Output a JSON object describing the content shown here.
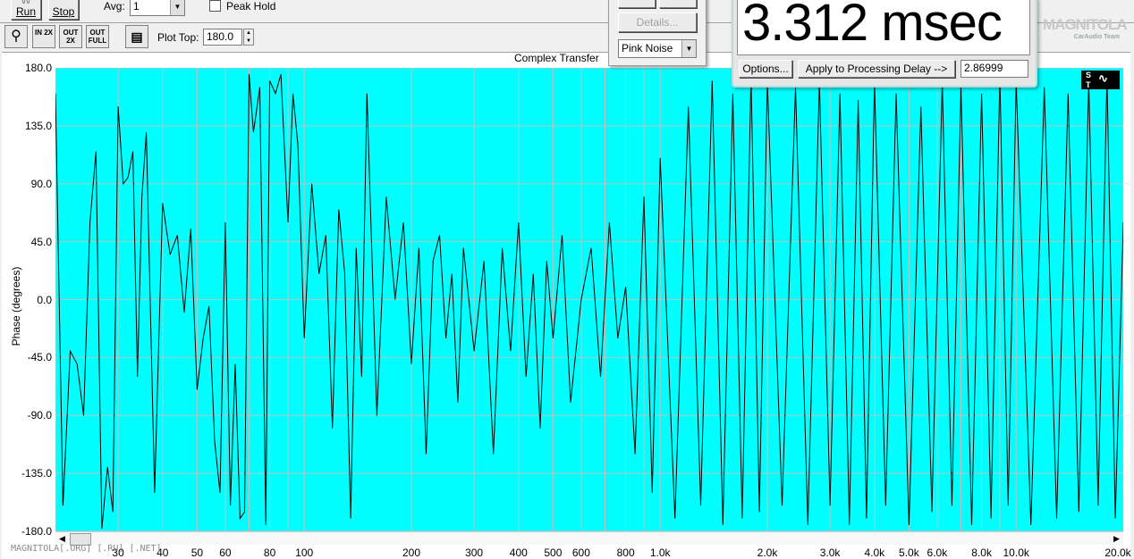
{
  "toolbar": {
    "run_label": "Run",
    "stop_label": "Stop",
    "avg_label": "Avg:",
    "avg_value": "1",
    "peak_hold_label": "Peak Hold",
    "plot_top_label": "Plot Top:",
    "plot_top_value": "180.0",
    "zoom_in_label": "IN 2X",
    "zoom_out_label": "OUT 2X",
    "zoom_full_label": "OUT FULL"
  },
  "panel": {
    "details_label": "Details...",
    "signal_select": "Pink Noise"
  },
  "delay": {
    "display": "3.312 msec",
    "options_label": "Options...",
    "apply_label": "Apply to Processing Delay -->",
    "apply_value": "2.86999"
  },
  "watermark": {
    "logo_text": "MAGNITOLA",
    "logo_sub": "CarAudio Team",
    "footer_text": "MAGNITOLA[.ORG] [.RU] [.NET]"
  },
  "chart_data": {
    "type": "line",
    "title": "Complex Transfer",
    "ylabel": "Phase (degrees)",
    "xlabel": "",
    "x_scale": "log",
    "xlim": [
      20,
      20000
    ],
    "ylim": [
      -180,
      180
    ],
    "grid": true,
    "y_ticks": [
      "180.0",
      "135.0",
      "90.0",
      "45.0",
      "0.0",
      "-45.0",
      "-90.0",
      "-135.0",
      "-180.0"
    ],
    "x_ticks": [
      {
        "value": 30,
        "label": "30"
      },
      {
        "value": 40,
        "label": "40"
      },
      {
        "value": 50,
        "label": "50"
      },
      {
        "value": 60,
        "label": "60"
      },
      {
        "value": 80,
        "label": "80"
      },
      {
        "value": 100,
        "label": "100"
      },
      {
        "value": 200,
        "label": "200"
      },
      {
        "value": 300,
        "label": "300"
      },
      {
        "value": 400,
        "label": "400"
      },
      {
        "value": 500,
        "label": "500"
      },
      {
        "value": 600,
        "label": "600"
      },
      {
        "value": 800,
        "label": "800"
      },
      {
        "value": 1000,
        "label": "1.0k"
      },
      {
        "value": 2000,
        "label": "2.0k"
      },
      {
        "value": 3000,
        "label": "3.0k"
      },
      {
        "value": 4000,
        "label": "4.0k"
      },
      {
        "value": 5000,
        "label": "5.0k"
      },
      {
        "value": 6000,
        "label": "6.0k"
      },
      {
        "value": 8000,
        "label": "8.0k"
      },
      {
        "value": 10000,
        "label": "10.0k"
      },
      {
        "value": 20000,
        "label": "20.0k"
      }
    ],
    "series": [
      {
        "color": "#000000",
        "x": [
          20,
          21,
          22,
          23,
          24,
          25,
          26,
          27,
          28,
          29,
          30,
          31,
          32,
          33,
          34,
          35,
          36,
          38,
          40,
          42,
          44,
          46,
          48,
          50,
          52,
          54,
          56,
          58,
          60,
          62,
          64,
          66,
          68,
          70,
          72,
          75,
          78,
          80,
          83,
          86,
          90,
          93,
          96,
          100,
          105,
          110,
          115,
          120,
          125,
          130,
          135,
          140,
          145,
          150,
          160,
          170,
          180,
          190,
          200,
          210,
          220,
          230,
          240,
          250,
          260,
          270,
          280,
          290,
          300,
          320,
          340,
          360,
          380,
          400,
          420,
          440,
          460,
          480,
          500,
          530,
          560,
          600,
          640,
          680,
          720,
          760,
          800,
          850,
          900,
          950,
          1000,
          1100,
          1200,
          1300,
          1400,
          1500,
          1600,
          1700,
          1800,
          1900,
          2000,
          2200,
          2400,
          2600,
          2800,
          3000,
          3200,
          3400,
          3600,
          3800,
          4000,
          4300,
          4600,
          5000,
          5400,
          5800,
          6200,
          6600,
          7000,
          7500,
          8000,
          8500,
          9000,
          9500,
          10000,
          11000,
          12000,
          13000,
          14000,
          15000,
          16000,
          17000,
          18000,
          19000,
          20000
        ],
        "y": [
          160,
          -160,
          -40,
          -50,
          -90,
          60,
          115,
          -178,
          -130,
          -165,
          150,
          90,
          95,
          115,
          -60,
          80,
          130,
          -150,
          75,
          35,
          50,
          -10,
          55,
          -70,
          -30,
          -5,
          -110,
          -150,
          60,
          -160,
          -50,
          -170,
          -165,
          175,
          130,
          165,
          -175,
          170,
          160,
          175,
          60,
          160,
          120,
          -30,
          90,
          20,
          50,
          -100,
          70,
          20,
          -170,
          40,
          -60,
          160,
          -90,
          80,
          0,
          60,
          -50,
          40,
          -120,
          30,
          50,
          -30,
          20,
          -80,
          40,
          0,
          -40,
          30,
          -120,
          40,
          -40,
          60,
          -60,
          20,
          -100,
          30,
          -30,
          50,
          -80,
          0,
          40,
          -60,
          60,
          -30,
          10,
          -120,
          80,
          -150,
          110,
          -170,
          150,
          -160,
          170,
          -175,
          160,
          -170,
          175,
          -165,
          170,
          -160,
          165,
          -175,
          170,
          -160,
          160,
          -175,
          155,
          -170,
          170,
          -160,
          160,
          -175,
          150,
          -165,
          170,
          -160,
          165,
          -175,
          160,
          -170,
          175,
          -160,
          170,
          -175,
          165,
          -170,
          160,
          -165,
          170,
          -160,
          175,
          -170,
          60
        ]
      }
    ]
  }
}
